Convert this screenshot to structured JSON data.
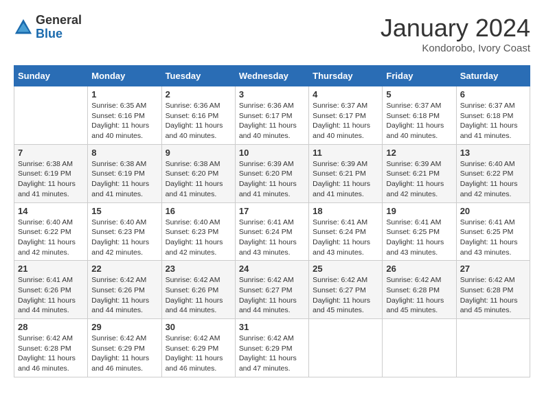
{
  "logo": {
    "general": "General",
    "blue": "Blue"
  },
  "title": "January 2024",
  "location": "Kondorobo, Ivory Coast",
  "weekdays": [
    "Sunday",
    "Monday",
    "Tuesday",
    "Wednesday",
    "Thursday",
    "Friday",
    "Saturday"
  ],
  "weeks": [
    [
      {
        "day": "",
        "sunrise": "",
        "sunset": "",
        "daylight": ""
      },
      {
        "day": "1",
        "sunrise": "Sunrise: 6:35 AM",
        "sunset": "Sunset: 6:16 PM",
        "daylight": "Daylight: 11 hours and 40 minutes."
      },
      {
        "day": "2",
        "sunrise": "Sunrise: 6:36 AM",
        "sunset": "Sunset: 6:16 PM",
        "daylight": "Daylight: 11 hours and 40 minutes."
      },
      {
        "day": "3",
        "sunrise": "Sunrise: 6:36 AM",
        "sunset": "Sunset: 6:17 PM",
        "daylight": "Daylight: 11 hours and 40 minutes."
      },
      {
        "day": "4",
        "sunrise": "Sunrise: 6:37 AM",
        "sunset": "Sunset: 6:17 PM",
        "daylight": "Daylight: 11 hours and 40 minutes."
      },
      {
        "day": "5",
        "sunrise": "Sunrise: 6:37 AM",
        "sunset": "Sunset: 6:18 PM",
        "daylight": "Daylight: 11 hours and 40 minutes."
      },
      {
        "day": "6",
        "sunrise": "Sunrise: 6:37 AM",
        "sunset": "Sunset: 6:18 PM",
        "daylight": "Daylight: 11 hours and 41 minutes."
      }
    ],
    [
      {
        "day": "7",
        "sunrise": "Sunrise: 6:38 AM",
        "sunset": "Sunset: 6:19 PM",
        "daylight": "Daylight: 11 hours and 41 minutes."
      },
      {
        "day": "8",
        "sunrise": "Sunrise: 6:38 AM",
        "sunset": "Sunset: 6:19 PM",
        "daylight": "Daylight: 11 hours and 41 minutes."
      },
      {
        "day": "9",
        "sunrise": "Sunrise: 6:38 AM",
        "sunset": "Sunset: 6:20 PM",
        "daylight": "Daylight: 11 hours and 41 minutes."
      },
      {
        "day": "10",
        "sunrise": "Sunrise: 6:39 AM",
        "sunset": "Sunset: 6:20 PM",
        "daylight": "Daylight: 11 hours and 41 minutes."
      },
      {
        "day": "11",
        "sunrise": "Sunrise: 6:39 AM",
        "sunset": "Sunset: 6:21 PM",
        "daylight": "Daylight: 11 hours and 41 minutes."
      },
      {
        "day": "12",
        "sunrise": "Sunrise: 6:39 AM",
        "sunset": "Sunset: 6:21 PM",
        "daylight": "Daylight: 11 hours and 42 minutes."
      },
      {
        "day": "13",
        "sunrise": "Sunrise: 6:40 AM",
        "sunset": "Sunset: 6:22 PM",
        "daylight": "Daylight: 11 hours and 42 minutes."
      }
    ],
    [
      {
        "day": "14",
        "sunrise": "Sunrise: 6:40 AM",
        "sunset": "Sunset: 6:22 PM",
        "daylight": "Daylight: 11 hours and 42 minutes."
      },
      {
        "day": "15",
        "sunrise": "Sunrise: 6:40 AM",
        "sunset": "Sunset: 6:23 PM",
        "daylight": "Daylight: 11 hours and 42 minutes."
      },
      {
        "day": "16",
        "sunrise": "Sunrise: 6:40 AM",
        "sunset": "Sunset: 6:23 PM",
        "daylight": "Daylight: 11 hours and 42 minutes."
      },
      {
        "day": "17",
        "sunrise": "Sunrise: 6:41 AM",
        "sunset": "Sunset: 6:24 PM",
        "daylight": "Daylight: 11 hours and 43 minutes."
      },
      {
        "day": "18",
        "sunrise": "Sunrise: 6:41 AM",
        "sunset": "Sunset: 6:24 PM",
        "daylight": "Daylight: 11 hours and 43 minutes."
      },
      {
        "day": "19",
        "sunrise": "Sunrise: 6:41 AM",
        "sunset": "Sunset: 6:25 PM",
        "daylight": "Daylight: 11 hours and 43 minutes."
      },
      {
        "day": "20",
        "sunrise": "Sunrise: 6:41 AM",
        "sunset": "Sunset: 6:25 PM",
        "daylight": "Daylight: 11 hours and 43 minutes."
      }
    ],
    [
      {
        "day": "21",
        "sunrise": "Sunrise: 6:41 AM",
        "sunset": "Sunset: 6:26 PM",
        "daylight": "Daylight: 11 hours and 44 minutes."
      },
      {
        "day": "22",
        "sunrise": "Sunrise: 6:42 AM",
        "sunset": "Sunset: 6:26 PM",
        "daylight": "Daylight: 11 hours and 44 minutes."
      },
      {
        "day": "23",
        "sunrise": "Sunrise: 6:42 AM",
        "sunset": "Sunset: 6:26 PM",
        "daylight": "Daylight: 11 hours and 44 minutes."
      },
      {
        "day": "24",
        "sunrise": "Sunrise: 6:42 AM",
        "sunset": "Sunset: 6:27 PM",
        "daylight": "Daylight: 11 hours and 44 minutes."
      },
      {
        "day": "25",
        "sunrise": "Sunrise: 6:42 AM",
        "sunset": "Sunset: 6:27 PM",
        "daylight": "Daylight: 11 hours and 45 minutes."
      },
      {
        "day": "26",
        "sunrise": "Sunrise: 6:42 AM",
        "sunset": "Sunset: 6:28 PM",
        "daylight": "Daylight: 11 hours and 45 minutes."
      },
      {
        "day": "27",
        "sunrise": "Sunrise: 6:42 AM",
        "sunset": "Sunset: 6:28 PM",
        "daylight": "Daylight: 11 hours and 45 minutes."
      }
    ],
    [
      {
        "day": "28",
        "sunrise": "Sunrise: 6:42 AM",
        "sunset": "Sunset: 6:28 PM",
        "daylight": "Daylight: 11 hours and 46 minutes."
      },
      {
        "day": "29",
        "sunrise": "Sunrise: 6:42 AM",
        "sunset": "Sunset: 6:29 PM",
        "daylight": "Daylight: 11 hours and 46 minutes."
      },
      {
        "day": "30",
        "sunrise": "Sunrise: 6:42 AM",
        "sunset": "Sunset: 6:29 PM",
        "daylight": "Daylight: 11 hours and 46 minutes."
      },
      {
        "day": "31",
        "sunrise": "Sunrise: 6:42 AM",
        "sunset": "Sunset: 6:29 PM",
        "daylight": "Daylight: 11 hours and 47 minutes."
      },
      {
        "day": "",
        "sunrise": "",
        "sunset": "",
        "daylight": ""
      },
      {
        "day": "",
        "sunrise": "",
        "sunset": "",
        "daylight": ""
      },
      {
        "day": "",
        "sunrise": "",
        "sunset": "",
        "daylight": ""
      }
    ]
  ]
}
